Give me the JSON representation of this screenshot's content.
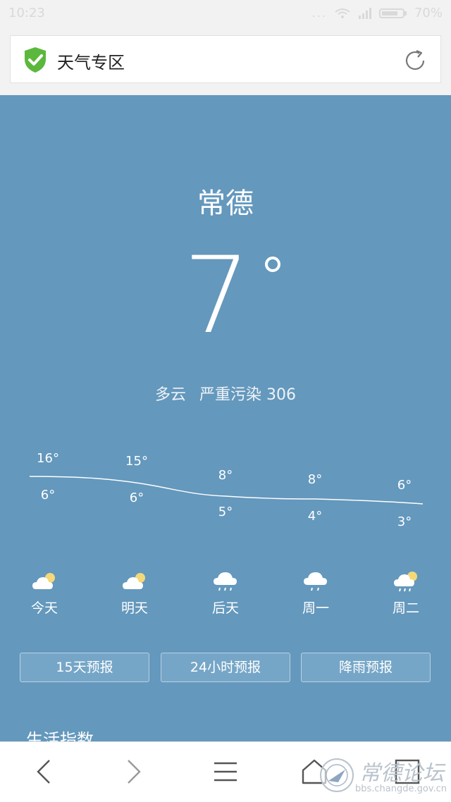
{
  "status_bar": {
    "time": "10:23",
    "dots": "...",
    "battery": "70%"
  },
  "header": {
    "title": "天气专区",
    "icons": {
      "shield": "shield-check-icon",
      "refresh": "refresh-icon"
    }
  },
  "weather": {
    "city": "常德",
    "temperature": "7",
    "condition": "多云",
    "air_quality": "严重污染 306"
  },
  "forecast": [
    {
      "high": "16°",
      "low": "6°",
      "day": "今天",
      "icon": "partly-cloudy-icon"
    },
    {
      "high": "15°",
      "low": "6°",
      "day": "明天",
      "icon": "partly-cloudy-icon"
    },
    {
      "high": "8°",
      "low": "5°",
      "day": "后天",
      "icon": "rain-cloud-icon"
    },
    {
      "high": "8°",
      "low": "4°",
      "day": "周一",
      "icon": "rain-cloud-icon"
    },
    {
      "high": "6°",
      "low": "3°",
      "day": "周二",
      "icon": "sun-rain-cloud-icon"
    }
  ],
  "buttons": {
    "forecast15": "15天预报",
    "hourly24": "24小时预报",
    "rain": "降雨预报"
  },
  "life": {
    "title": "生活指数"
  },
  "watermark": {
    "cn": "常德论坛",
    "url": "bbs.changde.gov.cn"
  },
  "colors": {
    "background": "#6498bd",
    "shield": "#5cb83c",
    "accent_white": "#ffffff"
  }
}
